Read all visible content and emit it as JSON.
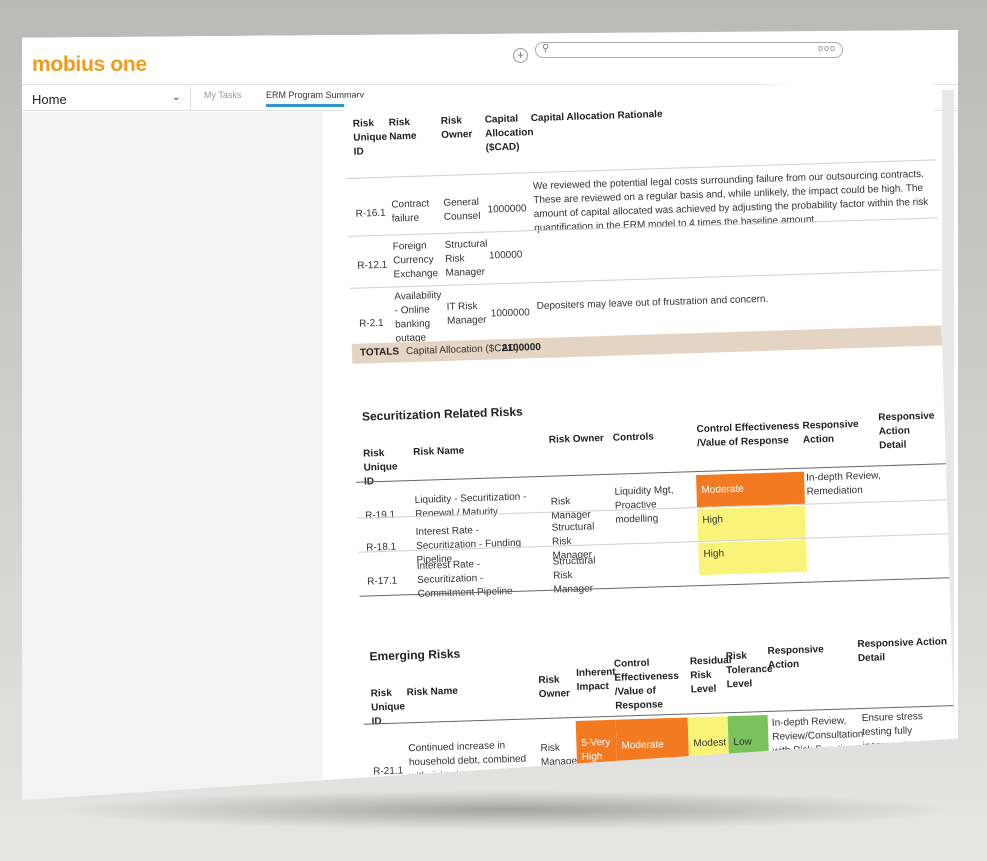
{
  "app": {
    "logo": "mobius one"
  },
  "topbar": {
    "add_icon": "plus-circle-icon",
    "search": {
      "value": "",
      "more": "ooo"
    }
  },
  "nav": {
    "home_label": "Home",
    "tabs": [
      {
        "label": "My Tasks"
      },
      {
        "label": "ERM Program Summary"
      }
    ]
  },
  "capital_table": {
    "headers": [
      "Risk Unique ID",
      "Risk Name",
      "Risk Owner",
      "Capital Allocation ($CAD)",
      "Capital Allocation Rationale"
    ],
    "rows": [
      {
        "id": "R-16.1",
        "name": "Contract failure",
        "owner": "General Counsel",
        "capital": "1000000",
        "rationale": "We reviewed the potential legal costs surrounding failure from our outsourcing contracts. These are reviewed on a regular basis and, while unlikely, the impact could be high. The amount of capital allocated was achieved by adjusting the probability factor within the risk quantification in the ERM model to 4 times the baseline amount."
      },
      {
        "id": "R-12.1",
        "name": "Foreign Currency Exchange",
        "owner": "Structural Risk Manager",
        "capital": "100000",
        "rationale": ""
      },
      {
        "id": "R-2.1",
        "name": "Availability - Online banking outage",
        "owner": "IT Risk Manager",
        "capital": "1000000",
        "rationale": "Depositers may leave out of frustration and concern."
      }
    ],
    "totals_label": "TOTALS",
    "totals_text": "Capital Allocation ($CAD):",
    "totals_value": "2100000"
  },
  "securitization": {
    "title": "Securitization Related Risks",
    "headers": [
      "Risk Unique ID",
      "Risk Name",
      "Risk Owner",
      "Controls",
      "Control Effectiveness /Value of Response",
      "Responsive Action",
      "Responsive Action Detail"
    ],
    "rows": [
      {
        "id": "R-19.1",
        "name": "Liquidity - Securitization - Renewal / Maturity",
        "owner": "Risk Manager",
        "controls": "Liquidity Mgt, Proactive modelling",
        "effectiveness": "Moderate",
        "action": "In-depth Review, Remediation",
        "detail": ""
      },
      {
        "id": "R-18.1",
        "name": "Interest Rate - Securitization - Funding Pipeline",
        "owner": "Structural Risk Manager",
        "controls": "",
        "effectiveness": "High",
        "action": "",
        "detail": ""
      },
      {
        "id": "R-17.1",
        "name": "Interest Rate - Securitization - Commitment Pipeline",
        "owner": "Structural Risk Manager",
        "controls": "",
        "effectiveness": "High",
        "action": "",
        "detail": ""
      }
    ]
  },
  "emerging": {
    "title": "Emerging Risks",
    "headers": [
      "Risk Unique ID",
      "Risk Name",
      "Risk Owner",
      "Inherent Impact",
      "Control Effectiveness /Value of Response",
      "Residual Risk Level",
      "Risk Tolerance Level",
      "Responsive Action",
      "Responsive Action Detail"
    ],
    "rows": [
      {
        "id": "R-21.1",
        "name": "Continued increase in household debt, combined with rising interest rates",
        "owner": "Risk Manager",
        "impact": "5-Very High",
        "effectiveness": "Moderate",
        "residual": "Modest",
        "tolerance": "Low",
        "action": "In-depth Review, Review/Consultation with Risk Function",
        "detail": "Ensure stress testing fully incorporates potential scenarios."
      }
    ]
  },
  "colors": {
    "brand": "#f29a1a",
    "tab_accent": "#2f97c9",
    "moderate": "#f47a22",
    "high": "#faf37a",
    "low": "#7ac35c",
    "totals_band": "#e4d4c4"
  }
}
